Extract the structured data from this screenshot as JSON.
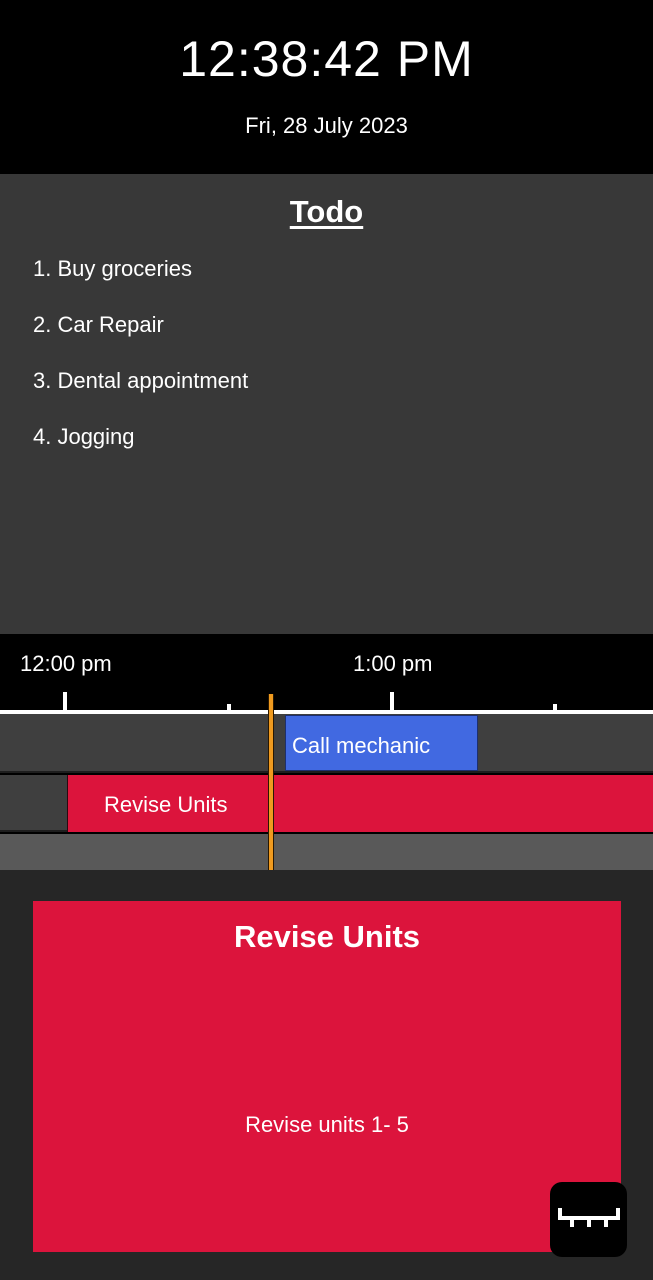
{
  "clock": {
    "time": "12:38:42 PM",
    "date": "Fri, 28 July 2023"
  },
  "todo": {
    "title": "Todo",
    "items": [
      "1. Buy groceries",
      "2. Car Repair",
      "3. Dental appointment",
      "4. Jogging"
    ]
  },
  "timeline": {
    "hour_labels": [
      "12:00 pm",
      "1:00 pm"
    ],
    "events": [
      {
        "title": "Call mechanic",
        "color": "#4169e1"
      },
      {
        "title": "Revise Units",
        "color": "#dc143c"
      }
    ],
    "now_marker_color": "#ef9a1f"
  },
  "detail": {
    "title": "Revise Units",
    "description": "Revise units 1- 5",
    "color": "#dc143c"
  },
  "fab": {
    "icon": "timeline-ruler-icon"
  }
}
